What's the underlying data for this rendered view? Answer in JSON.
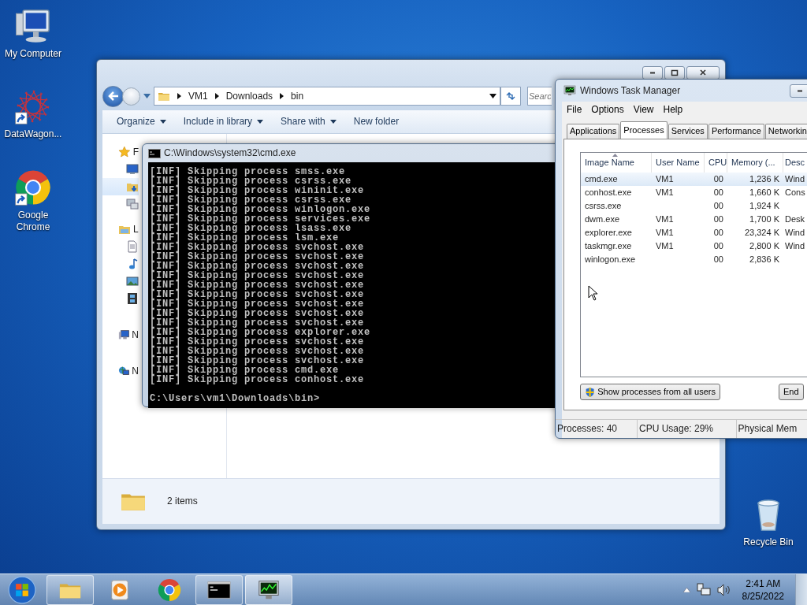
{
  "desktop_icons": [
    {
      "kind": "computer",
      "label": "My Computer",
      "shortcut": false
    },
    {
      "kind": "starburst",
      "label": "DataWagon...",
      "shortcut": true
    },
    {
      "kind": "chrome",
      "label": "Google Chrome",
      "shortcut": true
    },
    {
      "kind": "recycle",
      "label": "Recycle Bin",
      "shortcut": false
    }
  ],
  "explorer": {
    "breadcrumb": [
      "VM1",
      "Downloads",
      "bin"
    ],
    "search": {
      "placeholder": "Searc"
    },
    "toolbar": [
      {
        "label": "Organize",
        "dropdown": true
      },
      {
        "label": "Include in library",
        "dropdown": true
      },
      {
        "label": "Share with",
        "dropdown": true
      },
      {
        "label": "New folder",
        "dropdown": false
      }
    ],
    "sidebar": [
      {
        "kind": "favorites",
        "label": "F",
        "selected": false,
        "children": [
          {
            "kind": "desktop",
            "selected": false
          },
          {
            "kind": "downloads",
            "selected": true
          },
          {
            "kind": "recent",
            "selected": false
          }
        ]
      },
      {
        "kind": "libraries",
        "label": "L",
        "selected": false,
        "children": [
          {
            "kind": "documents",
            "selected": false
          },
          {
            "kind": "music",
            "selected": false
          },
          {
            "kind": "pictures",
            "selected": false
          },
          {
            "kind": "videos",
            "selected": false
          }
        ]
      },
      {
        "kind": "computer",
        "label": "N",
        "selected": false
      },
      {
        "kind": "network",
        "label": "N",
        "selected": false
      }
    ],
    "details": "2 items"
  },
  "console": {
    "title": "C:\\Windows\\system32\\cmd.exe",
    "lines": [
      "[INF] Skipping process smss.exe",
      "[INF] Skipping process csrss.exe",
      "[INF] Skipping process wininit.exe",
      "[INF] Skipping process csrss.exe",
      "[INF] Skipping process winlogon.exe",
      "[INF] Skipping process services.exe",
      "[INF] Skipping process lsass.exe",
      "[INF] Skipping process lsm.exe",
      "[INF] Skipping process svchost.exe",
      "[INF] Skipping process svchost.exe",
      "[INF] Skipping process svchost.exe",
      "[INF] Skipping process svchost.exe",
      "[INF] Skipping process svchost.exe",
      "[INF] Skipping process svchost.exe",
      "[INF] Skipping process svchost.exe",
      "[INF] Skipping process svchost.exe",
      "[INF] Skipping process svchost.exe",
      "[INF] Skipping process explorer.exe",
      "[INF] Skipping process svchost.exe",
      "[INF] Skipping process svchost.exe",
      "[INF] Skipping process svchost.exe",
      "[INF] Skipping process cmd.exe",
      "[INF] Skipping process conhost.exe"
    ],
    "prompt": "C:\\Users\\vm1\\Downloads\\bin>"
  },
  "task_manager": {
    "title": "Windows Task Manager",
    "menu": [
      "File",
      "Options",
      "View",
      "Help"
    ],
    "tabs": [
      {
        "label": "Applications",
        "selected": false
      },
      {
        "label": "Processes",
        "selected": true
      },
      {
        "label": "Services",
        "selected": false
      },
      {
        "label": "Performance",
        "selected": false
      },
      {
        "label": "Networkin",
        "selected": false
      }
    ],
    "columns": [
      "Image Name",
      "User Name",
      "CPU",
      "Memory (...",
      "Desc"
    ],
    "rows": [
      {
        "name": "cmd.exe",
        "user": "VM1",
        "cpu": "00",
        "memory": "1,236 K",
        "description": "Wind",
        "selected": true
      },
      {
        "name": "conhost.exe",
        "user": "VM1",
        "cpu": "00",
        "memory": "1,660 K",
        "description": "Cons",
        "selected": false
      },
      {
        "name": "csrss.exe",
        "cpu": "00",
        "memory": "1,924 K",
        "selected": false
      },
      {
        "name": "dwm.exe",
        "user": "VM1",
        "cpu": "00",
        "memory": "1,700 K",
        "description": "Desk",
        "selected": false
      },
      {
        "name": "explorer.exe",
        "user": "VM1",
        "cpu": "00",
        "memory": "23,324 K",
        "description": "Wind",
        "selected": false
      },
      {
        "name": "taskmgr.exe",
        "user": "VM1",
        "cpu": "00",
        "memory": "2,800 K",
        "description": "Wind",
        "selected": false
      },
      {
        "name": "winlogon.exe",
        "cpu": "00",
        "memory": "2,836 K",
        "selected": false
      }
    ],
    "buttons": [
      "Show processes from all users",
      "End"
    ],
    "status": [
      "Processes: 40",
      "CPU Usage: 29%",
      "Physical Mem"
    ]
  },
  "taskbar": {
    "items": [
      {
        "kind": "explorer",
        "running": true,
        "active": false
      },
      {
        "kind": "media",
        "running": false,
        "active": false
      },
      {
        "kind": "chrome",
        "running": false,
        "active": false
      },
      {
        "kind": "cmd",
        "running": true,
        "active": false
      },
      {
        "kind": "taskmgr",
        "running": true,
        "active": true
      }
    ],
    "clock": {
      "time": "2:41 AM",
      "date": "8/25/2022"
    }
  }
}
